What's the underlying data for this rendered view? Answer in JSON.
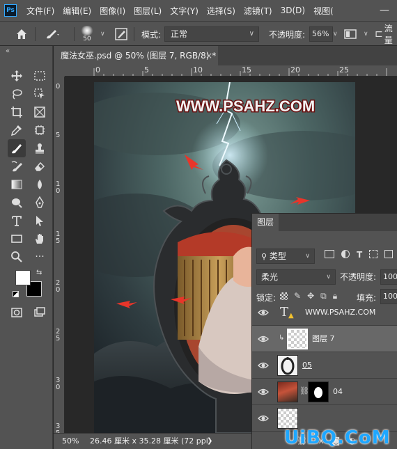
{
  "app": {
    "logo_text": "Ps"
  },
  "menu": [
    "文件(F)",
    "编辑(E)",
    "图像(I)",
    "图层(L)",
    "文字(Y)",
    "选择(S)",
    "滤镜(T)",
    "3D(D)",
    "视图("
  ],
  "options": {
    "brush_size": "50",
    "mode_label": "模式:",
    "mode_value": "正常",
    "opacity_label": "不透明度:",
    "opacity_value": "56%",
    "flow_label": "流量"
  },
  "document": {
    "tab_title": "魔法女巫.psd @ 50% (图层 7, RGB/8) *",
    "close": "×",
    "ruler_h": [
      "0",
      "5",
      "10",
      "15",
      "20",
      "25"
    ],
    "ruler_v": [
      "0",
      "5",
      "1 0",
      "1 5",
      "2 0",
      "2 5",
      "3 0",
      "3 5"
    ],
    "watermark": "WWW.PSAHZ.COM"
  },
  "status": {
    "zoom": "50%",
    "doc_size": "26.46 厘米 x 35.28 厘米 (72 ppi)",
    "arrow": "❯"
  },
  "layers_panel": {
    "tab": "图层",
    "filter_label": "类型",
    "blend_mode": "柔光",
    "opacity_label": "不透明度:",
    "opacity_value": "100",
    "lock_label": "锁定:",
    "fill_label": "填充:",
    "fill_value": "100",
    "layers": [
      {
        "name": "WWW.PSAHZ.COM",
        "kind": "text",
        "selected": false
      },
      {
        "name": "图层 7",
        "kind": "pixel",
        "selected": true
      },
      {
        "name": "05",
        "kind": "mirror",
        "selected": false
      },
      {
        "name": "04",
        "kind": "photo-mask",
        "selected": false
      },
      {
        "name": "",
        "kind": "pixel",
        "selected": false
      }
    ]
  },
  "site_watermark": "UiBQ.CoM",
  "colors": {
    "ui_dark": "#535353",
    "canvas_bg": "#282828",
    "accent": "#31a8ff",
    "selected_row": "#686868"
  }
}
